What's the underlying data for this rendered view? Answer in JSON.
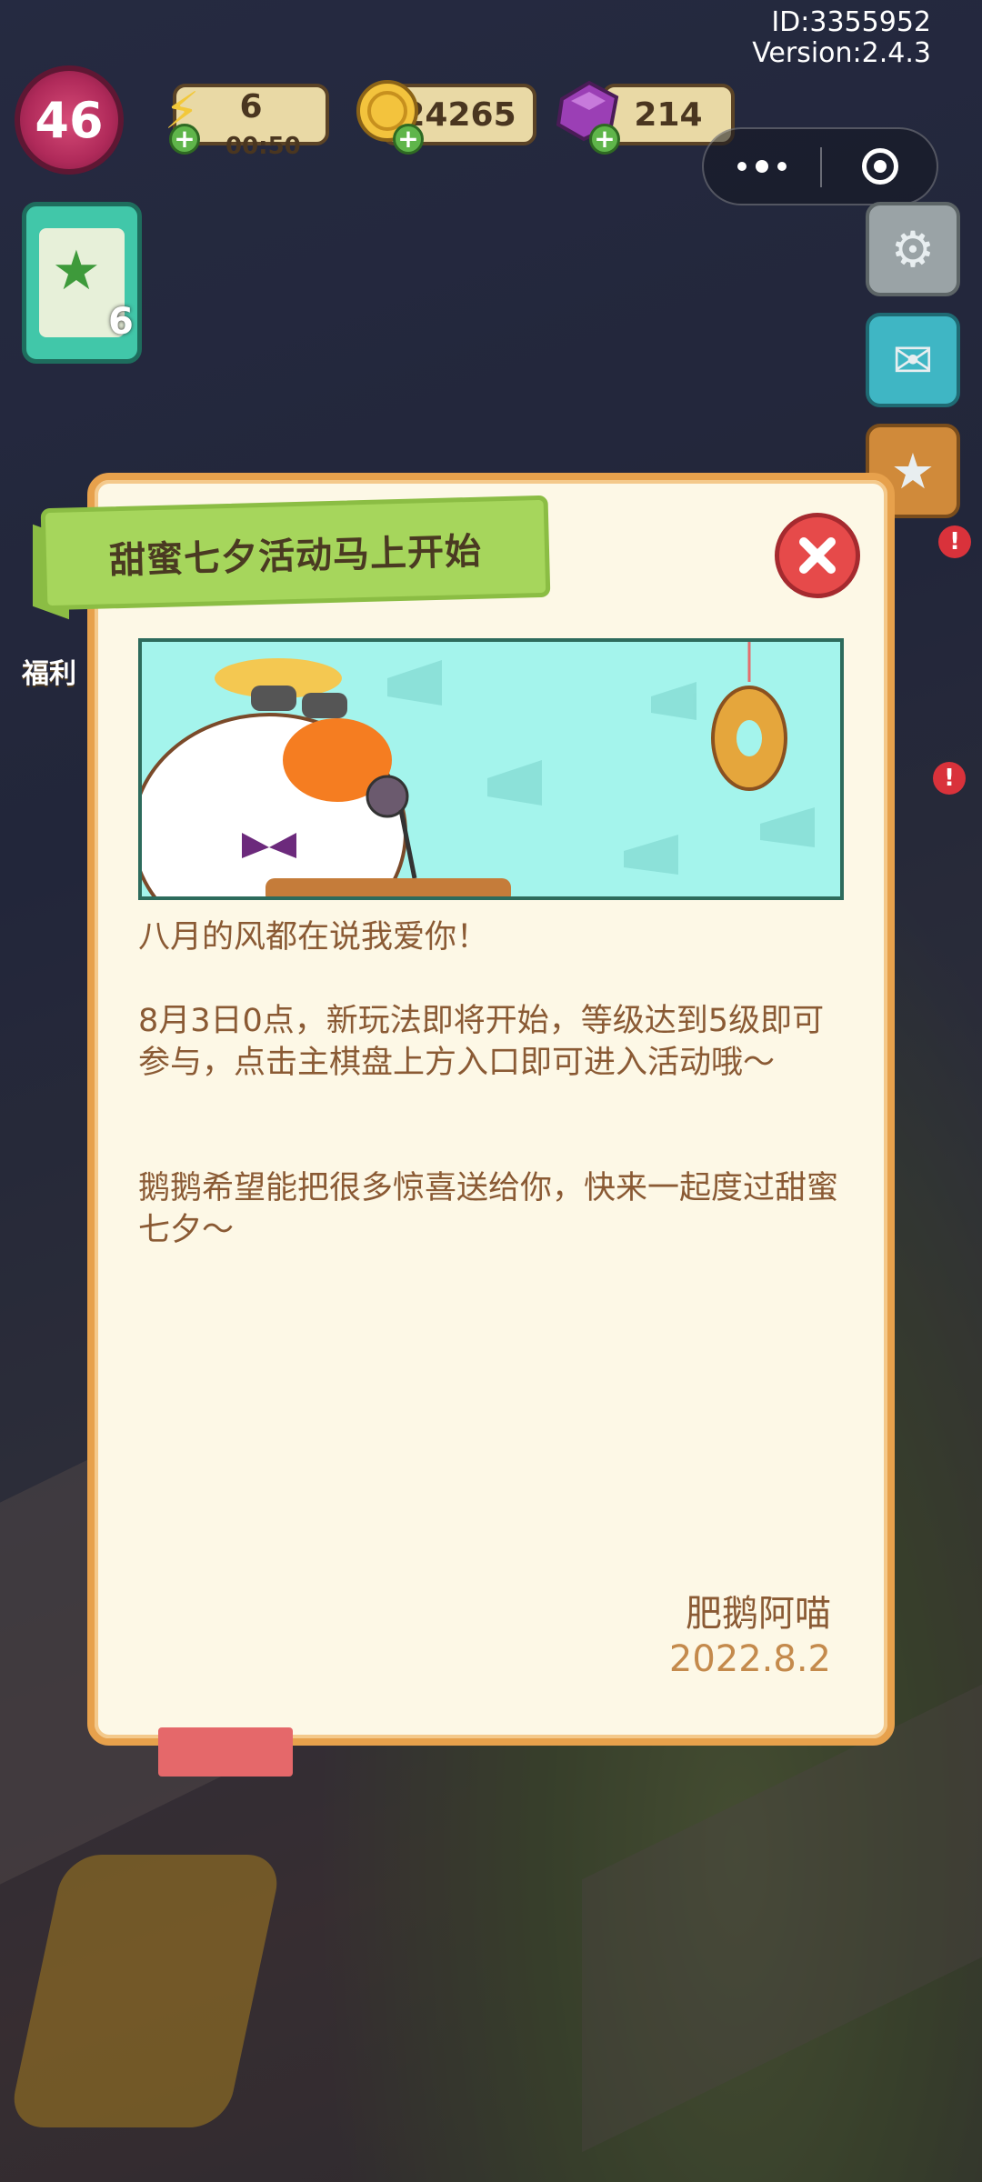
{
  "info": {
    "id": "ID:3355952",
    "version": "Version:2.4.3"
  },
  "hud": {
    "level": "46",
    "energy": {
      "value": "6",
      "timer": "00:50"
    },
    "coins": "24265",
    "gems": "214",
    "task_count": "6",
    "welfare_label": "福利"
  },
  "icons": {
    "energy": "lightning-icon",
    "coin": "coin-icon",
    "gem": "gem-icon",
    "settings": "gear-icon",
    "mail": "mail-icon",
    "trophy": "star-trophy-icon",
    "close": "close-icon",
    "more": "more-dots-icon",
    "target": "target-icon"
  },
  "dialog": {
    "title": "甜蜜七夕活动马上开始",
    "para1": "八月的风都在说我爱你！",
    "para2": "8月3日0点，新玩法即将开始，等级达到5级即可参与，点击主棋盘上方入口即可进入活动哦～",
    "para3": "鹅鹅希望能把很多惊喜送给你，快来一起度过甜蜜七夕～",
    "signature": "肥鹅阿喵",
    "date": "2022.8.2"
  },
  "colors": {
    "dialog_bg": "#fdf8e6",
    "dialog_border": "#e7a14c",
    "banner": "#a6d65c",
    "text": "#8a5a34",
    "date": "#c48a4c",
    "close": "#e64a4a",
    "hero_bg": "#a4f4ec"
  }
}
